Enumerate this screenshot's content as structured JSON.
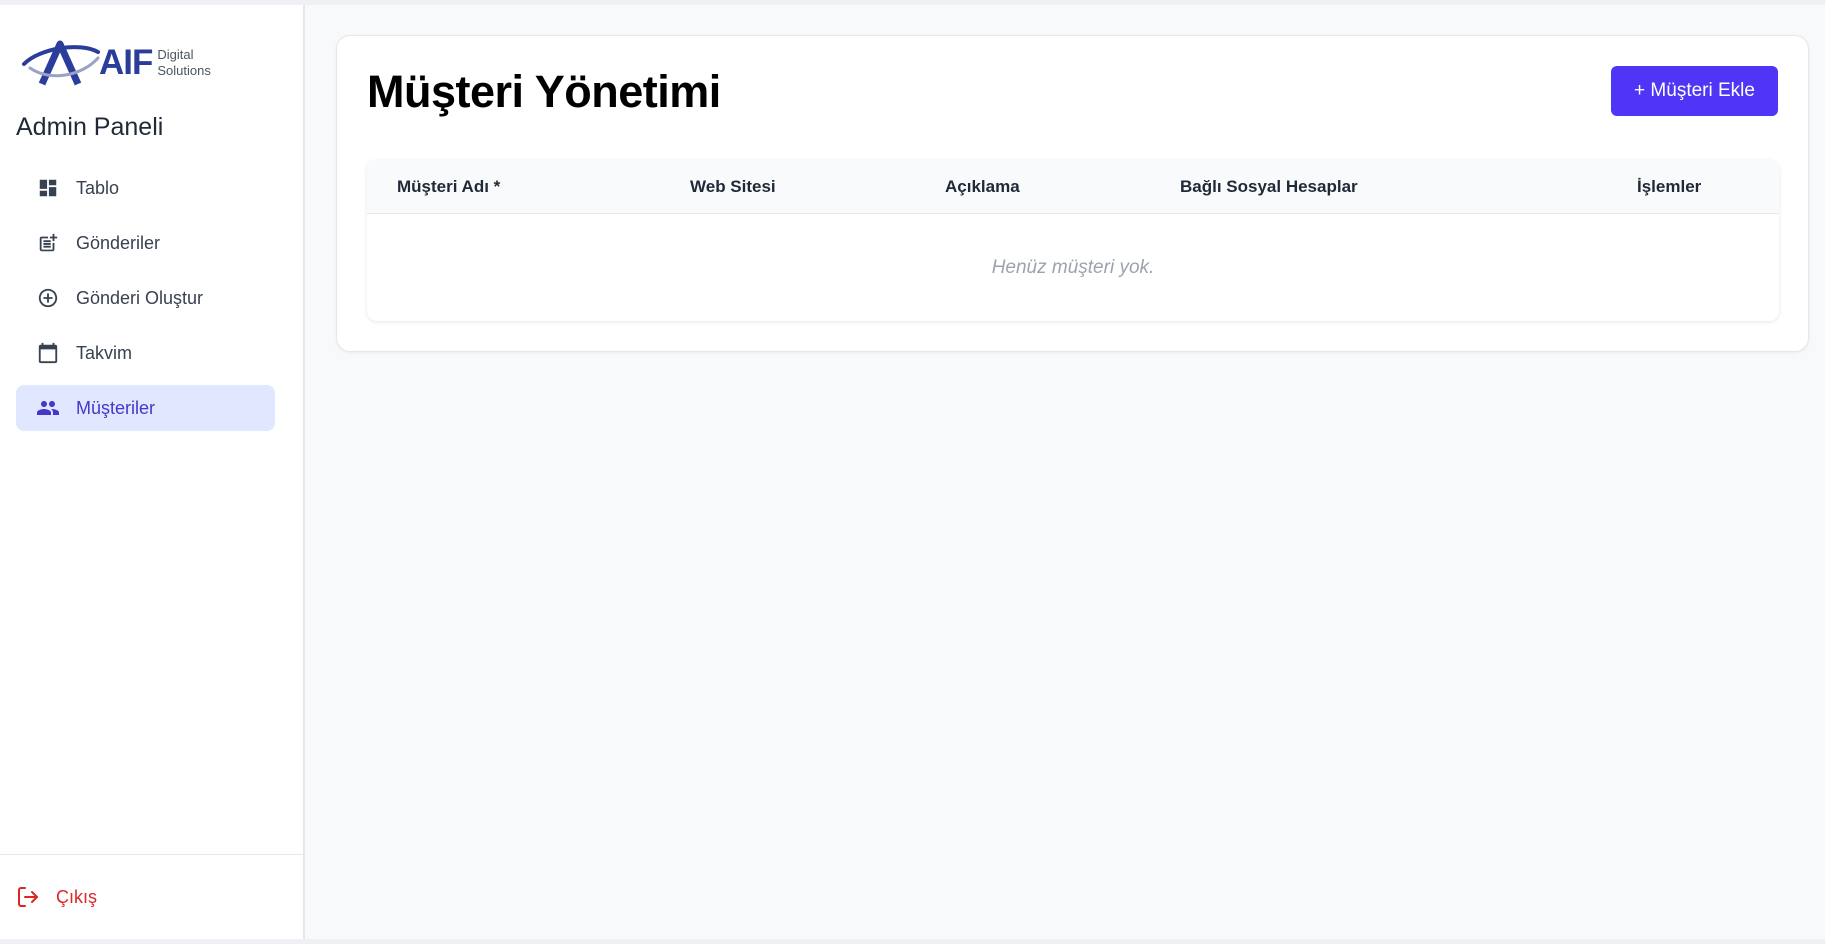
{
  "brand": {
    "logo_text": "AIF",
    "logo_sub_1": "Digital",
    "logo_sub_2": "Solutions"
  },
  "sidebar": {
    "title": "Admin Paneli",
    "items": [
      {
        "label": "Tablo",
        "icon": "dashboard-icon",
        "active": false
      },
      {
        "label": "Gönderiler",
        "icon": "post-add-icon",
        "active": false
      },
      {
        "label": "Gönderi Oluştur",
        "icon": "add-circle-icon",
        "active": false
      },
      {
        "label": "Takvim",
        "icon": "calendar-icon",
        "active": false
      },
      {
        "label": "Müşteriler",
        "icon": "people-icon",
        "active": true
      }
    ],
    "logout_label": "Çıkış"
  },
  "main": {
    "title": "Müşteri Yönetimi",
    "add_button": "+ Müşteri Ekle",
    "table": {
      "columns": [
        "Müşteri Adı *",
        "Web Sitesi",
        "Açıklama",
        "Bağlı Sosyal Hesaplar",
        "İşlemler"
      ],
      "empty_message": "Henüz müşteri yok."
    }
  },
  "colors": {
    "accent": "#4f35f5",
    "active_bg": "#e0e7ff",
    "active_text": "#4338ca",
    "danger": "#dc2626",
    "brand": "#2b3d9a"
  }
}
